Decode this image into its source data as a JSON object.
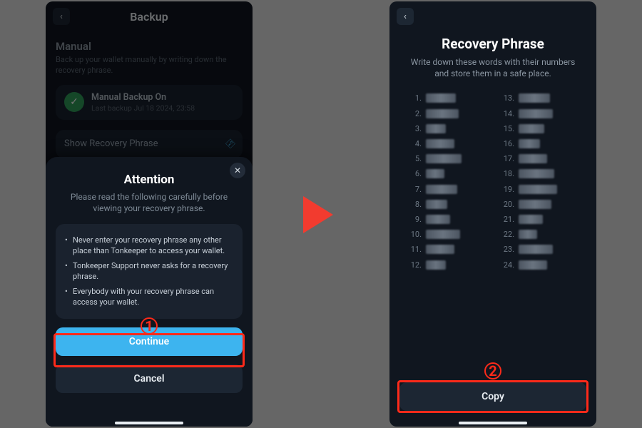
{
  "left": {
    "header_title": "Backup",
    "section_title": "Manual",
    "section_sub": "Back up your wallet manually by writing down the recovery phrase.",
    "backup_card": {
      "title": "Manual Backup On",
      "subtitle": "Last backup Jul 18 2024, 23:58"
    },
    "show_phrase_label": "Show Recovery Phrase",
    "modal": {
      "title": "Attention",
      "lead": "Please read the following carefully before viewing your recovery phrase.",
      "warnings": [
        "Never enter your recovery phrase any other place than Tonkeeper to access your wallet.",
        "Tonkeeper Support never asks for a recovery phrase.",
        "Everybody with your recovery phrase can access your wallet."
      ],
      "continue_label": "Continue",
      "cancel_label": "Cancel"
    },
    "step_badge": "1"
  },
  "right": {
    "title": "Recovery Phrase",
    "sub": "Write down these words with their numbers and store them in a safe place.",
    "word_count": 24,
    "copy_label": "Copy",
    "step_badge": "2"
  },
  "colors": {
    "accent": "#3db4ef",
    "highlight": "#ff2a1a",
    "bg": "#10161f"
  }
}
